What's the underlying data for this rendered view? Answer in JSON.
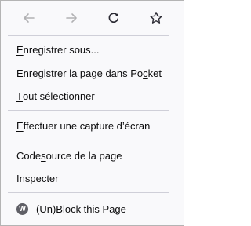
{
  "nav": {
    "back_icon": "arrow-left-icon",
    "forward_icon": "arrow-right-icon",
    "reload_icon": "reload-icon",
    "bookmark_icon": "star-icon"
  },
  "menu": {
    "save_as": {
      "pre": "",
      "key": "E",
      "post": "nregistrer sous..."
    },
    "save_pocket": {
      "pre": "Enregistrer la page dans Po",
      "key": "c",
      "post": "ket"
    },
    "select_all": {
      "pre": "",
      "key": "T",
      "post": "out sélectionner"
    },
    "screenshot": {
      "pre": "",
      "key": "E",
      "post": "ffectuer une capture d’écran"
    },
    "view_source": {
      "pre": "Code ",
      "key": "s",
      "post": "ource de la page"
    },
    "inspect": {
      "pre": "",
      "key": "I",
      "post": "nspecter"
    },
    "extension": {
      "icon_letter": "W",
      "label": "(Un)Block this Page"
    }
  }
}
